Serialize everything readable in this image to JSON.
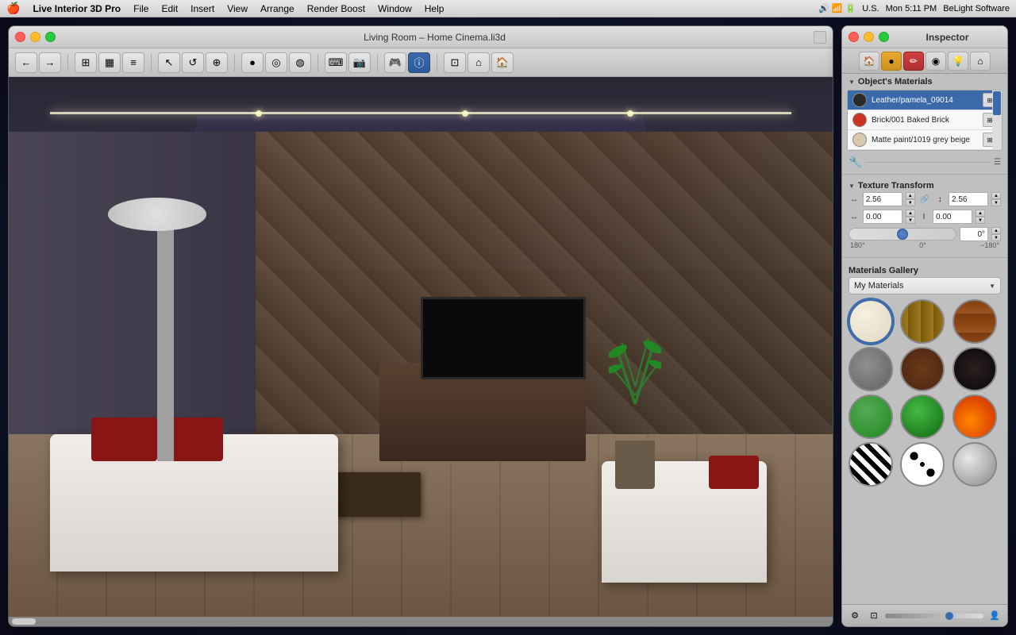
{
  "menubar": {
    "apple": "🍎",
    "items": [
      {
        "label": "Live Interior 3D Pro",
        "bold": true
      },
      {
        "label": "File"
      },
      {
        "label": "Edit"
      },
      {
        "label": "Insert"
      },
      {
        "label": "View"
      },
      {
        "label": "Arrange"
      },
      {
        "label": "Render Boost"
      },
      {
        "label": "Window"
      },
      {
        "label": "Help"
      }
    ],
    "right": {
      "time": "Mon 5:11 PM",
      "brand": "BeLight Software",
      "locale": "U.S."
    }
  },
  "window": {
    "title": "Living Room – Home Cinema.li3d",
    "traffic_lights": [
      "close",
      "minimize",
      "maximize"
    ]
  },
  "toolbar": {
    "buttons": [
      "←",
      "→",
      "⊞",
      "▦",
      "≡",
      "◉",
      "◎",
      "◍",
      "⌨",
      "📷",
      "🎮",
      "ⓘ",
      "⊡",
      "⊟",
      "⌂"
    ]
  },
  "inspector": {
    "title": "Inspector",
    "tabs": [
      {
        "icon": "🏠",
        "tooltip": "Object"
      },
      {
        "icon": "●",
        "tooltip": "Material",
        "active": true
      },
      {
        "icon": "✏",
        "tooltip": "Edit"
      },
      {
        "icon": "◉",
        "tooltip": "Texture"
      },
      {
        "icon": "💡",
        "tooltip": "Light"
      },
      {
        "icon": "⌂",
        "tooltip": "Room"
      }
    ],
    "materials_section": {
      "title": "Object's Materials",
      "items": [
        {
          "name": "Leather/pamela_09014",
          "swatch_class": "swatch-dark"
        },
        {
          "name": "Brick/001 Baked Brick",
          "swatch_class": "swatch-red"
        },
        {
          "name": "Matte paint/1019 grey beige",
          "swatch_class": "swatch-beige"
        }
      ]
    },
    "texture_transform": {
      "title": "Texture Transform",
      "scale_x_label": "↔",
      "scale_x_value": "2.56",
      "scale_y_label": "↕",
      "scale_y_value": "2.56",
      "offset_x_label": "↔",
      "offset_x_value": "0.00",
      "offset_y_label": "↕",
      "offset_y_value": "0.00",
      "angle_value": "0°",
      "angle_min": "180°",
      "angle_zero": "0°",
      "angle_max": "−180°"
    },
    "gallery": {
      "title": "Materials Gallery",
      "dropdown_value": "My Materials",
      "items": [
        {
          "class": "mat-cream",
          "selected": true
        },
        {
          "class": "mat-wood1",
          "selected": false
        },
        {
          "class": "mat-brick",
          "selected": false
        },
        {
          "class": "mat-stone",
          "selected": false
        },
        {
          "class": "mat-wood2",
          "selected": false
        },
        {
          "class": "mat-dark",
          "selected": false
        },
        {
          "class": "mat-green1",
          "selected": false
        },
        {
          "class": "mat-green2",
          "selected": false
        },
        {
          "class": "mat-fire",
          "selected": false
        },
        {
          "class": "mat-zebra",
          "selected": false
        },
        {
          "class": "mat-spots",
          "selected": false
        },
        {
          "class": "mat-metal",
          "selected": false
        }
      ]
    }
  }
}
